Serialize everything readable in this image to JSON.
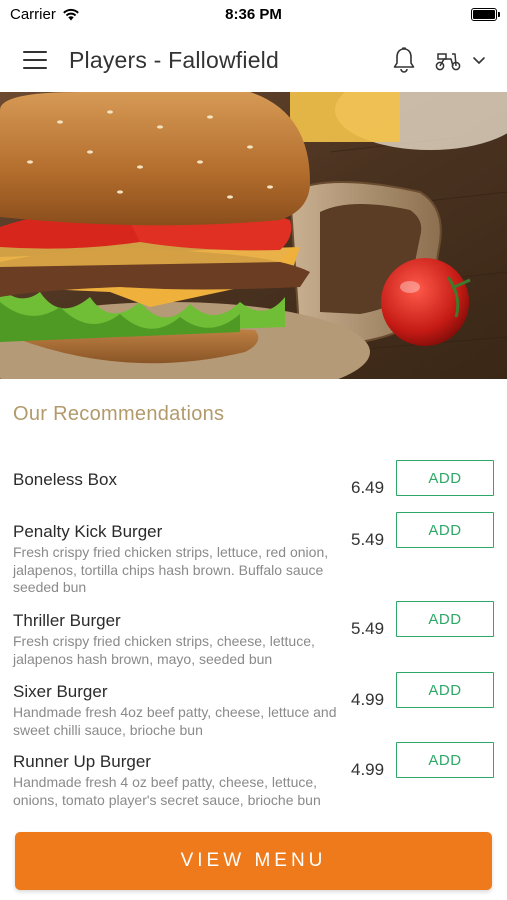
{
  "status_bar": {
    "carrier": "Carrier",
    "time": "8:36 PM"
  },
  "nav": {
    "title": "Players - Fallowfield"
  },
  "recommendations": {
    "title": "Our Recommendations",
    "items": [
      {
        "name": "Boneless Box",
        "description": "",
        "price": "6.49",
        "add_label": "ADD"
      },
      {
        "name": "Penalty Kick Burger",
        "description": "Fresh crispy fried chicken strips, lettuce, red onion, jalapenos, tortilla chips hash brown. Buffalo sauce seeded bun",
        "price": "5.49",
        "add_label": "ADD"
      },
      {
        "name": "Thriller Burger",
        "description": "Fresh crispy fried chicken strips, cheese, lettuce, jalapenos hash brown, mayo, seeded bun",
        "price": "5.49",
        "add_label": "ADD"
      },
      {
        "name": "Sixer Burger",
        "description": "Handmade fresh 4oz beef patty, cheese, lettuce and sweet chilli sauce,  brioche bun",
        "price": "4.99",
        "add_label": "ADD"
      },
      {
        "name": "Runner Up Burger",
        "description": "Handmade fresh 4 oz beef patty, cheese, lettuce, onions, tomato player's secret sauce, brioche bun",
        "price": "4.99",
        "add_label": "ADD"
      }
    ]
  },
  "view_menu_label": "VIEW MENU",
  "colors": {
    "accent_orange": "#ee7a1c",
    "add_green": "#2ea866",
    "section_title": "#b29a6c"
  },
  "icons": {
    "menu": "hamburger-menu-icon",
    "notifications": "bell-icon",
    "delivery_mode": "scooter-icon",
    "dropdown": "chevron-down-icon"
  }
}
